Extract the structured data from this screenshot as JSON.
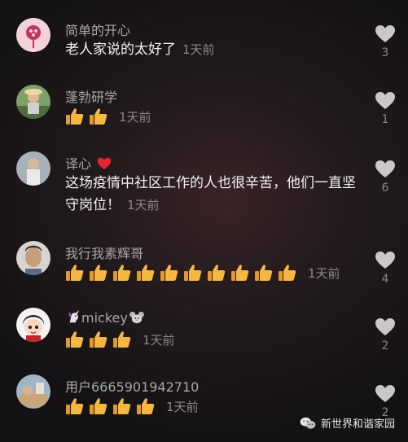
{
  "comments": [
    {
      "author": "简单的开心",
      "text": "老人家说的太好了",
      "thumb_count": 0,
      "time": "1天前",
      "likes": "3",
      "avatar_color": "#e8a7b4"
    },
    {
      "author": "蓬勃研学",
      "text": "",
      "thumb_count": 2,
      "time": "1天前",
      "likes": "1",
      "avatar_color": "#6f8a5b"
    },
    {
      "author": "译心",
      "author_suffix_icon": "red-heart-icon",
      "text": "这场疫情中社区工作的人也很辛苦，他们一直坚守岗位！",
      "thumb_count": 0,
      "time": "1天前",
      "likes": "6",
      "avatar_color": "#9aa0a8"
    },
    {
      "author": "我行我素辉哥",
      "text": "",
      "thumb_count": 10,
      "time": "1天前",
      "likes": "4",
      "avatar_color": "#b98c72"
    },
    {
      "author": "mickey",
      "author_prefix_icon": "unicorn-icon",
      "author_suffix_icon": "mouse-icon",
      "text": "",
      "thumb_count": 3,
      "time": "1天前",
      "likes": "2",
      "avatar_color": "#f2f2f2"
    },
    {
      "author": "用户6665901942710",
      "text": "",
      "thumb_count": 4,
      "time": "1天前",
      "likes": "2",
      "avatar_color": "#b9a27e"
    }
  ],
  "watermark": {
    "text": "新世界和谐家园",
    "icon": "wechat-icon"
  },
  "colors": {
    "background": "#1b1719",
    "heart": "#c9c7c8",
    "thumb": "#f4b740"
  }
}
